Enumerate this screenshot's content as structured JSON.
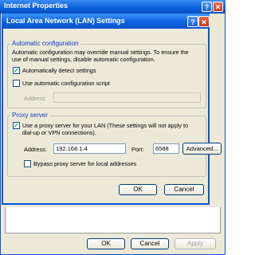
{
  "background_window": {
    "title": "Internet Properties",
    "help_glyph": "?",
    "close_glyph": "✕",
    "buttons": {
      "ok": "OK",
      "cancel": "Cancel",
      "apply": "Apply"
    }
  },
  "dialog": {
    "title": "Local Area Network (LAN) Settings",
    "help_glyph": "?",
    "close_glyph": "✕",
    "automatic_configuration": {
      "legend": "Automatic configuration",
      "description_line1": "Automatic configuration may override manual settings.  To ensure the",
      "description_line2": "use of manual settings, disable automatic configuration.",
      "detect_settings_label": "Automatically detect settings",
      "detect_settings_checked": true,
      "use_script_label": "Use automatic configuration script",
      "use_script_checked": false,
      "address_label": "Address",
      "address_value": ""
    },
    "proxy_server": {
      "legend": "Proxy server",
      "use_proxy_label_line1": "Use a proxy server for your LAN (These settings will not apply to",
      "use_proxy_label_line2": "dial-up or VPN connections).",
      "use_proxy_checked": true,
      "address_label": "Address:",
      "address_value": "192.168.1.4",
      "port_label": "Port:",
      "port_value": "6588",
      "advanced_button": "Advanced...",
      "bypass_label": "Bypass proxy server for local addresses",
      "bypass_checked": false
    },
    "buttons": {
      "ok": "OK",
      "cancel": "Cancel"
    }
  },
  "colors": {
    "titlebar": "#0a5fd8",
    "dialog_face": "#ece9d8",
    "legend_text": "#0a3ec8",
    "check_mark": "#21a121"
  }
}
